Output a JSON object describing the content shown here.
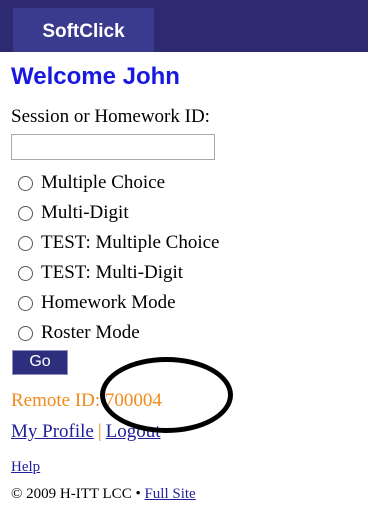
{
  "header": {
    "brand": "SoftClick"
  },
  "welcome": "Welcome John",
  "session": {
    "label": "Session or Homework ID:",
    "value": ""
  },
  "modes": [
    {
      "label": "Multiple Choice"
    },
    {
      "label": "Multi-Digit"
    },
    {
      "label": "TEST: Multiple Choice"
    },
    {
      "label": "TEST: Multi-Digit"
    },
    {
      "label": "Homework Mode"
    },
    {
      "label": "Roster Mode"
    }
  ],
  "go_label": "Go",
  "remote": {
    "text": "Remote ID: 700004"
  },
  "links": {
    "profile": "My Profile",
    "separator": "|",
    "logout": "Logout",
    "help": "Help"
  },
  "footer": {
    "copyright": "© 2009 H-ITT LCC •",
    "full_site": "Full Site"
  },
  "colors": {
    "header": "#2d2a72",
    "welcome": "#1818e0",
    "accent": "#f08a1a",
    "link": "#1f1f9a"
  }
}
